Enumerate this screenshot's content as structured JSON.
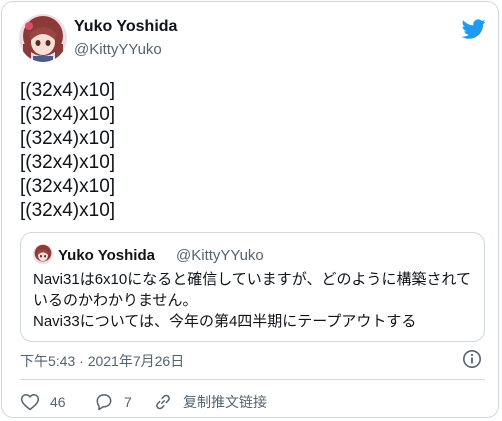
{
  "author": {
    "name": "Yuko Yoshida",
    "handle": "@KittyYYuko"
  },
  "tweet": {
    "lines": [
      "[(32x4)x10]",
      "[(32x4)x10]",
      "[(32x4)x10]",
      "[(32x4)x10]",
      "[(32x4)x10]",
      "[(32x4)x10]"
    ]
  },
  "quote": {
    "name": "Yuko Yoshida",
    "handle": "@KittyYYuko",
    "lines": [
      "Navi31は6x10になると確信していますが、どのように構築されて",
      "いるのかわかりません。",
      "Navi33については、今年の第4四半期にテープアウトする"
    ]
  },
  "meta": {
    "timestamp": "下午5:43 · 2021年7月26日"
  },
  "actions": {
    "likes": "46",
    "replies": "7",
    "copy_link": "复制推文链接"
  },
  "colors": {
    "twitter_blue": "#1d9bf0",
    "muted": "#536471",
    "border": "#cfd9de"
  },
  "icons": [
    "twitter-bird-icon",
    "info-icon",
    "heart-icon",
    "reply-icon",
    "link-icon"
  ]
}
